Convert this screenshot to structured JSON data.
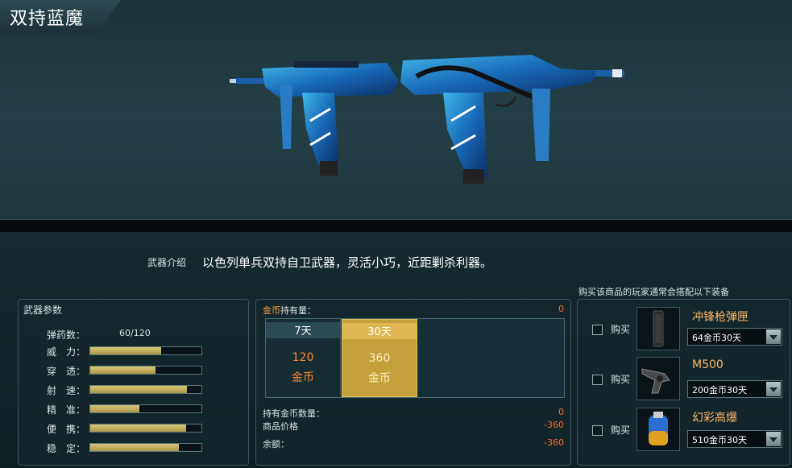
{
  "header": {
    "title": "双持蓝魔"
  },
  "intro": {
    "label": "武器介绍",
    "text": "以色列单兵双持自卫武器，灵活小巧，近距剿杀利器。"
  },
  "stats": {
    "title": "武器参数",
    "ammo_label": "弹药数：",
    "ammo_value": "60/120",
    "rows": [
      {
        "label": "威　力：",
        "value": 0.64
      },
      {
        "label": "穿　透：",
        "value": 0.59
      },
      {
        "label": "射　速：",
        "value": 0.87
      },
      {
        "label": "精　准：",
        "value": 0.44
      },
      {
        "label": "便　携：",
        "value": 0.86
      },
      {
        "label": "稳　定：",
        "value": 0.8
      }
    ]
  },
  "purchase": {
    "gold_label": "金币",
    "gold_label2": "持有量：",
    "gold_value": "0",
    "options": [
      {
        "days": "7天",
        "price": "120",
        "unit": "金币",
        "selected": false
      },
      {
        "days": "30天",
        "price": "360",
        "unit": "金币",
        "selected": true
      }
    ],
    "held_label": "持有金币数量：",
    "held_value": "0",
    "price_label": "商品价格",
    "price_value": "-360",
    "balance_label": "余额：",
    "balance_value": "-360"
  },
  "recommend": {
    "title": "购买该商品的玩家通常会搭配以下装备",
    "items": [
      {
        "buy": "购买",
        "name": "冲锋枪弹匣",
        "option": "64金币30天",
        "icon": "magazine-icon"
      },
      {
        "buy": "购买",
        "name": "M500",
        "option": "200金币30天",
        "icon": "revolver-icon"
      },
      {
        "buy": "购买",
        "name": "幻彩高爆",
        "option": "510金币30天",
        "icon": "grenade-icon"
      }
    ]
  },
  "colors": {
    "accent_gold": "#c4a03a",
    "price_orange": "#ff8a3a",
    "negative": "#ff6a2a",
    "stat_bar": "#d7c979"
  }
}
